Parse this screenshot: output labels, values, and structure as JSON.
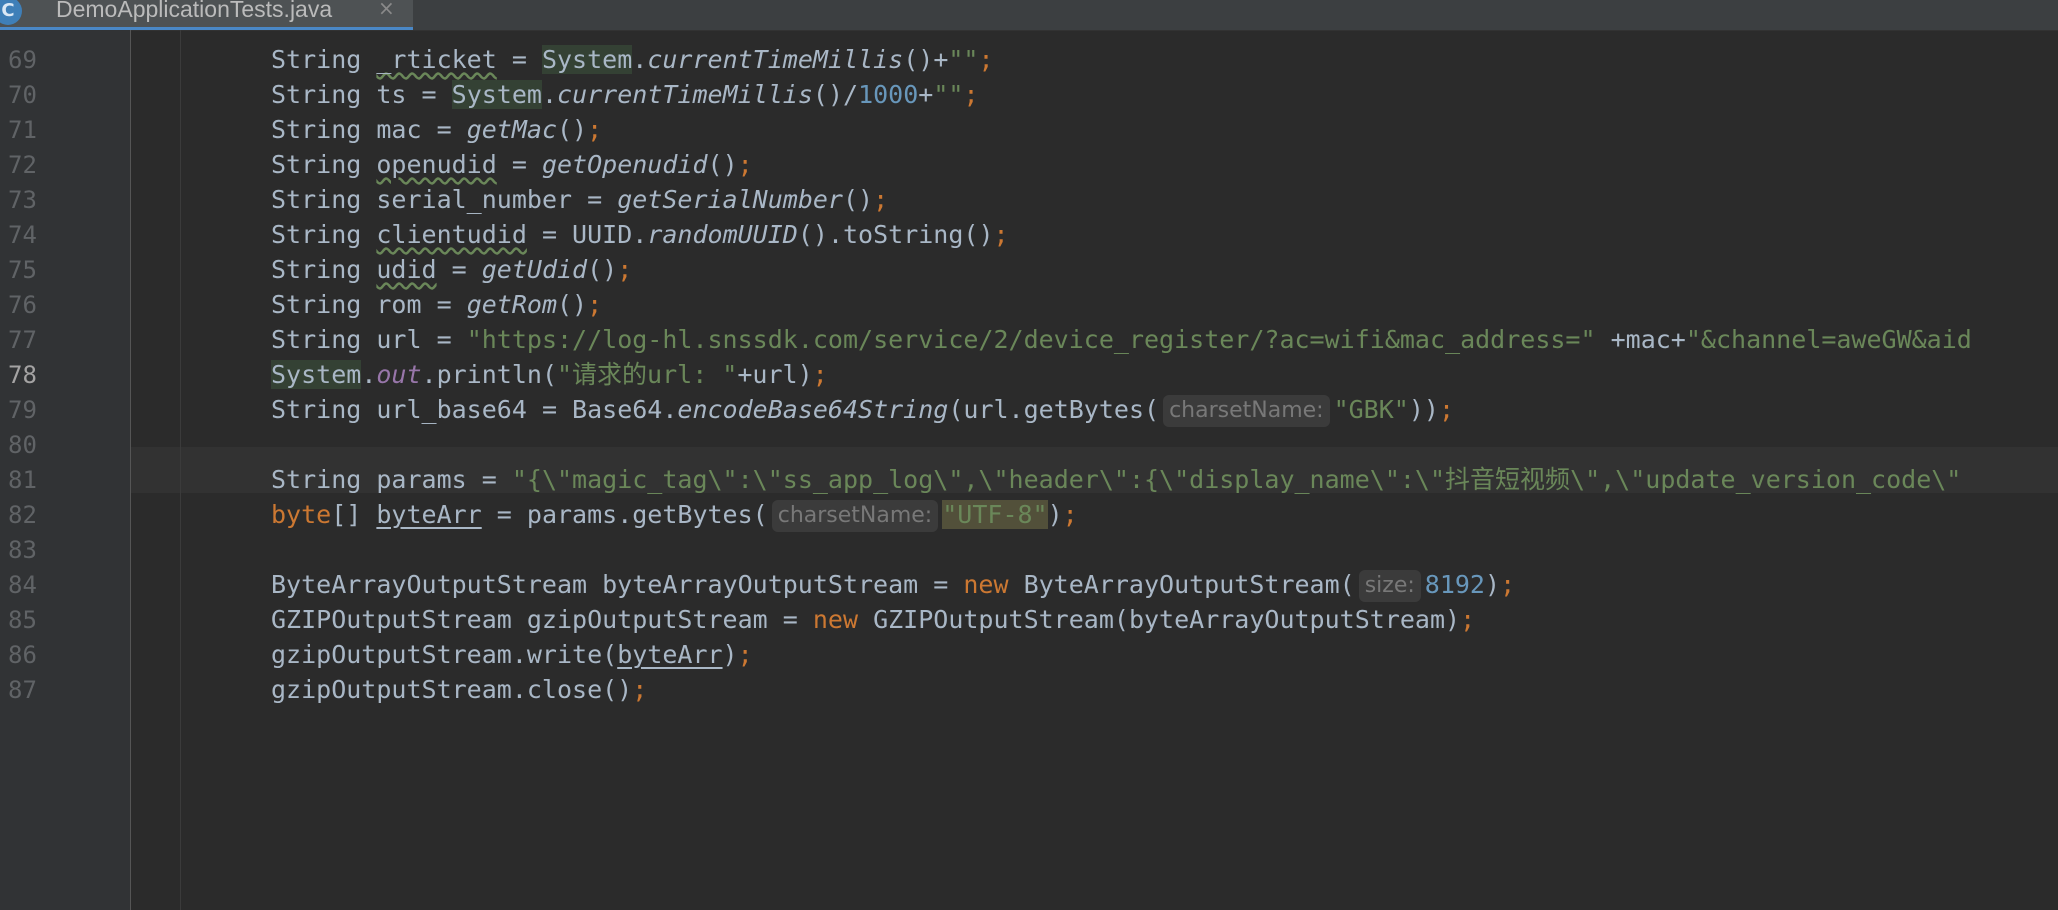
{
  "tab": {
    "icon_letter": "C",
    "filename": "DemoApplicationTests.java",
    "close_glyph": "×"
  },
  "gutter": {
    "line_numbers": [
      "69",
      "70",
      "71",
      "72",
      "73",
      "74",
      "75",
      "76",
      "77",
      "78",
      "79",
      "80",
      "81",
      "82",
      "83",
      "84",
      "85",
      "86",
      "87"
    ],
    "current_line": "78"
  },
  "code": {
    "l69": {
      "type": "String",
      "var": "_rticket",
      "eq": " = ",
      "cls": "System",
      "dot": ".",
      "call": "currentTimeMillis",
      "paren": "()",
      "plus": "+",
      "str": "\"\"",
      "semi": ";"
    },
    "l70": {
      "type": "String",
      "var": "ts",
      "eq": " = ",
      "cls": "System",
      "dot": ".",
      "call": "currentTimeMillis",
      "paren": "()",
      "div": "/",
      "num": "1000",
      "plus": "+",
      "str": "\"\"",
      "semi": ";"
    },
    "l71": {
      "type": "String",
      "var": "mac",
      "eq": " = ",
      "call": "getMac",
      "paren": "()",
      "semi": ";"
    },
    "l72": {
      "type": "String",
      "var": "openudid",
      "eq": " = ",
      "call": "getOpenudid",
      "paren": "()",
      "semi": ";"
    },
    "l73": {
      "type": "String",
      "var": "serial_number",
      "eq": " = ",
      "call": "getSerialNumber",
      "paren": "()",
      "semi": ";"
    },
    "l74": {
      "type": "String",
      "var": "clientudid",
      "eq": " = ",
      "cls": "UUID.",
      "call": "randomUUID",
      "paren": "()",
      "tail": ".toString()",
      "semi": ";"
    },
    "l75": {
      "type": "String",
      "var": "udid",
      "eq": " = ",
      "call": "getUdid",
      "paren": "()",
      "semi": ";"
    },
    "l76": {
      "type": "String",
      "var": "rom",
      "eq": " = ",
      "call": "getRom",
      "paren": "()",
      "semi": ";"
    },
    "l77": {
      "type": "String",
      "var": "url",
      "eq": " = ",
      "str1": "\"https://log-hl.snssdk.com/service/2/device_register/?ac=wifi&mac_address=\"",
      "mid": " +mac+",
      "str2": "\"&channel=aweGW&aid"
    },
    "l78": {
      "cls": "System",
      "dot": ".",
      "field": "out",
      "call": ".println(",
      "str": "\"请求的url: \"",
      "tail": "+url)",
      "semi": ";"
    },
    "l79": {
      "type": "String",
      "var": "url_base64",
      "eq": " = ",
      "cls": "Base64.",
      "call": "encodeBase64String",
      "mid": "(url.getBytes(",
      "hint": "charsetName:",
      "str": "\"GBK\"",
      "tail": "))",
      "semi": ";"
    },
    "l81": {
      "type": "String",
      "var": "params",
      "eq": " = ",
      "str": "\"{\\\"magic_tag\\\":\\\"ss_app_log\\\",\\\"header\\\":{\\\"display_name\\\":\\\"抖音短视频\\\",\\\"update_version_code\\\""
    },
    "l82": {
      "kw": "byte",
      "type": "[] ",
      "var": "byteArr",
      "eq": " = params.getBytes(",
      "hint": "charsetName:",
      "str": "\"UTF-8\"",
      "tail": ")",
      "semi": ";"
    },
    "l84": {
      "type": "ByteArrayOutputStream byteArrayOutputStream = ",
      "kw": "new",
      "cls": " ByteArrayOutputStream(",
      "hint": "size:",
      "num": "8192",
      "tail": ")",
      "semi": ";"
    },
    "l85": {
      "type": "GZIPOutputStream gzipOutputStream = ",
      "kw": "new",
      "tail": " GZIPOutputStream(byteArrayOutputStream)",
      "semi": ";"
    },
    "l86": {
      "pre": "gzipOutputStream.write(",
      "var": "byteArr",
      "tail": ")",
      "semi": ";"
    },
    "l87": {
      "pre": "gzipOutputStream.close()",
      "semi": ";"
    }
  }
}
